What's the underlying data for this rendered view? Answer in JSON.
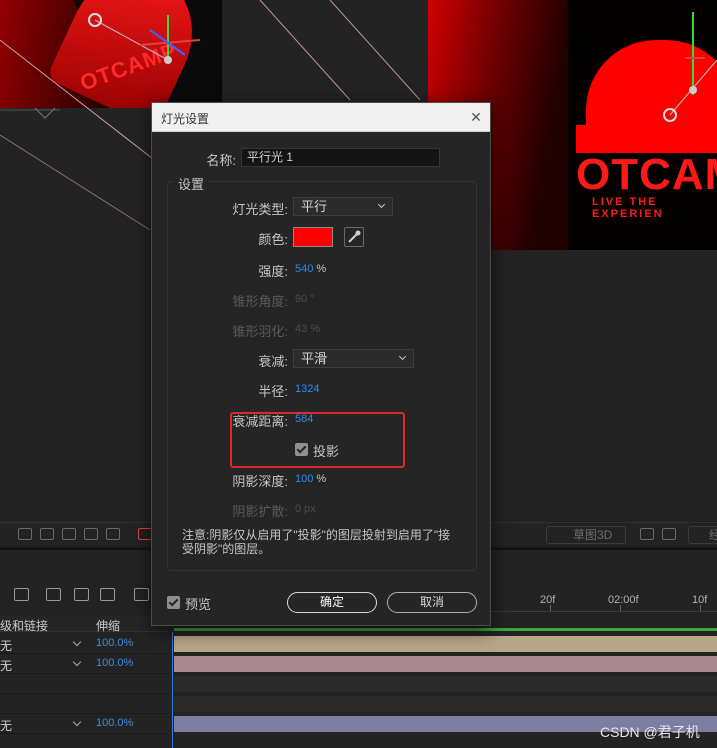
{
  "composition": {
    "left_logo_text": "OTCAMP",
    "right_brand": "OTCAMP",
    "right_tagline": "LIVE THE EXPERIEN"
  },
  "viewer_toolbar": {
    "draft3d_label": "草图3D",
    "extended_label": "经"
  },
  "dialog": {
    "title": "灯光设置",
    "name_label": "名称:",
    "name_value": "平行光 1",
    "settings_group": "设置",
    "light_type_label": "灯光类型:",
    "light_type_value": "平行",
    "color_label": "颜色:",
    "color_value": "#ff0000",
    "intensity_label": "强度:",
    "intensity_value": "540",
    "intensity_unit": "%",
    "cone_angle_label": "锥形角度:",
    "cone_angle_value": "90 °",
    "cone_feather_label": "锥形羽化:",
    "cone_feather_value": "43",
    "cone_feather_unit": "%",
    "falloff_label": "衰减:",
    "falloff_value": "平滑",
    "radius_label": "半径:",
    "radius_value": "1324",
    "falloff_distance_label": "衰减距离:",
    "falloff_distance_value": "584",
    "casts_shadows_label": "投影",
    "casts_shadows_checked": true,
    "shadow_darkness_label": "阴影深度:",
    "shadow_darkness_value": "100",
    "shadow_darkness_unit": "%",
    "shadow_diffusion_label": "阴影扩散:",
    "shadow_diffusion_value": "0 px",
    "note": "注意:阴影仅从启用了\"投影\"的图层投射到启用了\"接受阴影\"的图层。",
    "preview_label": "预览",
    "preview_checked": true,
    "ok_label": "确定",
    "cancel_label": "取消"
  },
  "timeline": {
    "columns": {
      "parent_link": "级和链接",
      "stretch": "伸缩"
    },
    "ruler_labels": [
      "20f",
      "02:00f",
      "10f"
    ],
    "layers": [
      {
        "parent": "无",
        "stretch": "100.0%",
        "color": "#b9a58a"
      },
      {
        "parent": "无",
        "stretch": "100.0%",
        "color": "#a98a92"
      },
      {
        "parent": "",
        "stretch": "",
        "color": ""
      },
      {
        "parent": "",
        "stretch": "",
        "color": ""
      },
      {
        "parent": "无",
        "stretch": "100.0%",
        "color": "#7b7ea0"
      }
    ]
  },
  "watermark": "CSDN @君子机"
}
